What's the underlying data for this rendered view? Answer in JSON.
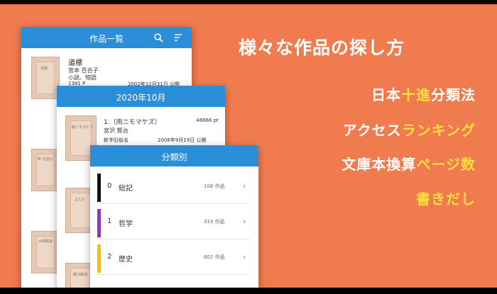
{
  "heading": "様々な作品の探し方",
  "features": [
    {
      "pre": "日本",
      "hl": "十進",
      "post": "分類法"
    },
    {
      "pre": "アクセス",
      "hl": "ランキング",
      "post": ""
    },
    {
      "pre": "文庫本換算",
      "hl": "ページ数",
      "post": ""
    },
    {
      "pre": "",
      "hl": "書きだし",
      "post": ""
    }
  ],
  "screen1": {
    "title": "作品一覧",
    "item": {
      "title": "道標",
      "author": "宮本 百合子",
      "genre": "小説、物語",
      "pages": "1381 P",
      "date": "2002年12月31日 公開"
    },
    "thumbs": [
      "道標",
      "新 お登以",
      "大岡政談"
    ]
  },
  "screen2": {
    "title": "2020年10月",
    "item": {
      "title": "1.〔雨ニモマケズ〕",
      "author": "宮沢 賢治",
      "extra": "新字旧仮名",
      "points": "48866 pt",
      "date": "2006年9月19日 公開"
    },
    "thumbs": [
      "雨ニモマケズ",
      "よだか",
      "銀河鉄道"
    ]
  },
  "screen3": {
    "title": "分類別",
    "rows": [
      {
        "num": "0",
        "name": "総記",
        "count": "106 作品",
        "color": "#111111"
      },
      {
        "num": "1",
        "name": "哲学",
        "count": "333 作品",
        "color": "#9b2fbf"
      },
      {
        "num": "2",
        "name": "歴史",
        "count": "602 作品",
        "color": "#f2c200"
      }
    ]
  },
  "icons": {
    "search": "search-icon",
    "sort": "sort-icon",
    "chevron": "chevron-right-icon"
  }
}
